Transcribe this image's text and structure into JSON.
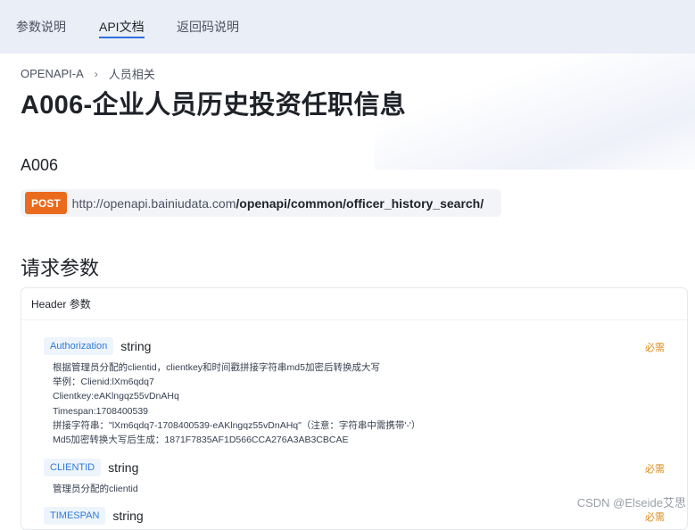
{
  "nav": {
    "tabs": [
      "参数说明",
      "API文档",
      "返回码说明"
    ],
    "active": 1
  },
  "breadcrumb": {
    "parent": "OPENAPI-A",
    "sep": "›",
    "current": "人员相关"
  },
  "page": {
    "title": "A006-企业人员历史投资任职信息",
    "code": "A006"
  },
  "endpoint": {
    "method": "POST",
    "base": "http://openapi.bainiudata.com",
    "path": "/openapi/common/officer_history_search/"
  },
  "request": {
    "title": "请求参数",
    "header_label": "Header 参数",
    "required_label": "必需",
    "params": [
      {
        "name": "Authorization",
        "type": "string",
        "desc": [
          "根据管理员分配的clientid，clientkey和时间戳拼接字符串md5加密后转换成大写",
          "举例：Clienid:lXm6qdq7",
          "Clientkey:eAKlngqz55vDnAHq",
          "Timespan:1708400539",
          "拼接字符串：\"lXm6qdq7-1708400539-eAKlngqz55vDnAHq\"（注意：字符串中需携带'-'）",
          "Md5加密转换大写后生成：1871F7835AF1D566CCA276A3AB3CBCAE"
        ]
      },
      {
        "name": "CLIENTID",
        "type": "string",
        "desc": [
          "管理员分配的clientid"
        ]
      },
      {
        "name": "TIMESPAN",
        "type": "string",
        "desc": []
      }
    ]
  },
  "watermark": "CSDN @Elseide艾思",
  "colors": {
    "accent": "#2f6fe0",
    "method": "#eb6b1e",
    "required": "#d98b18",
    "tag_bg": "#eef4fc",
    "tag_text": "#2e7bd9"
  }
}
